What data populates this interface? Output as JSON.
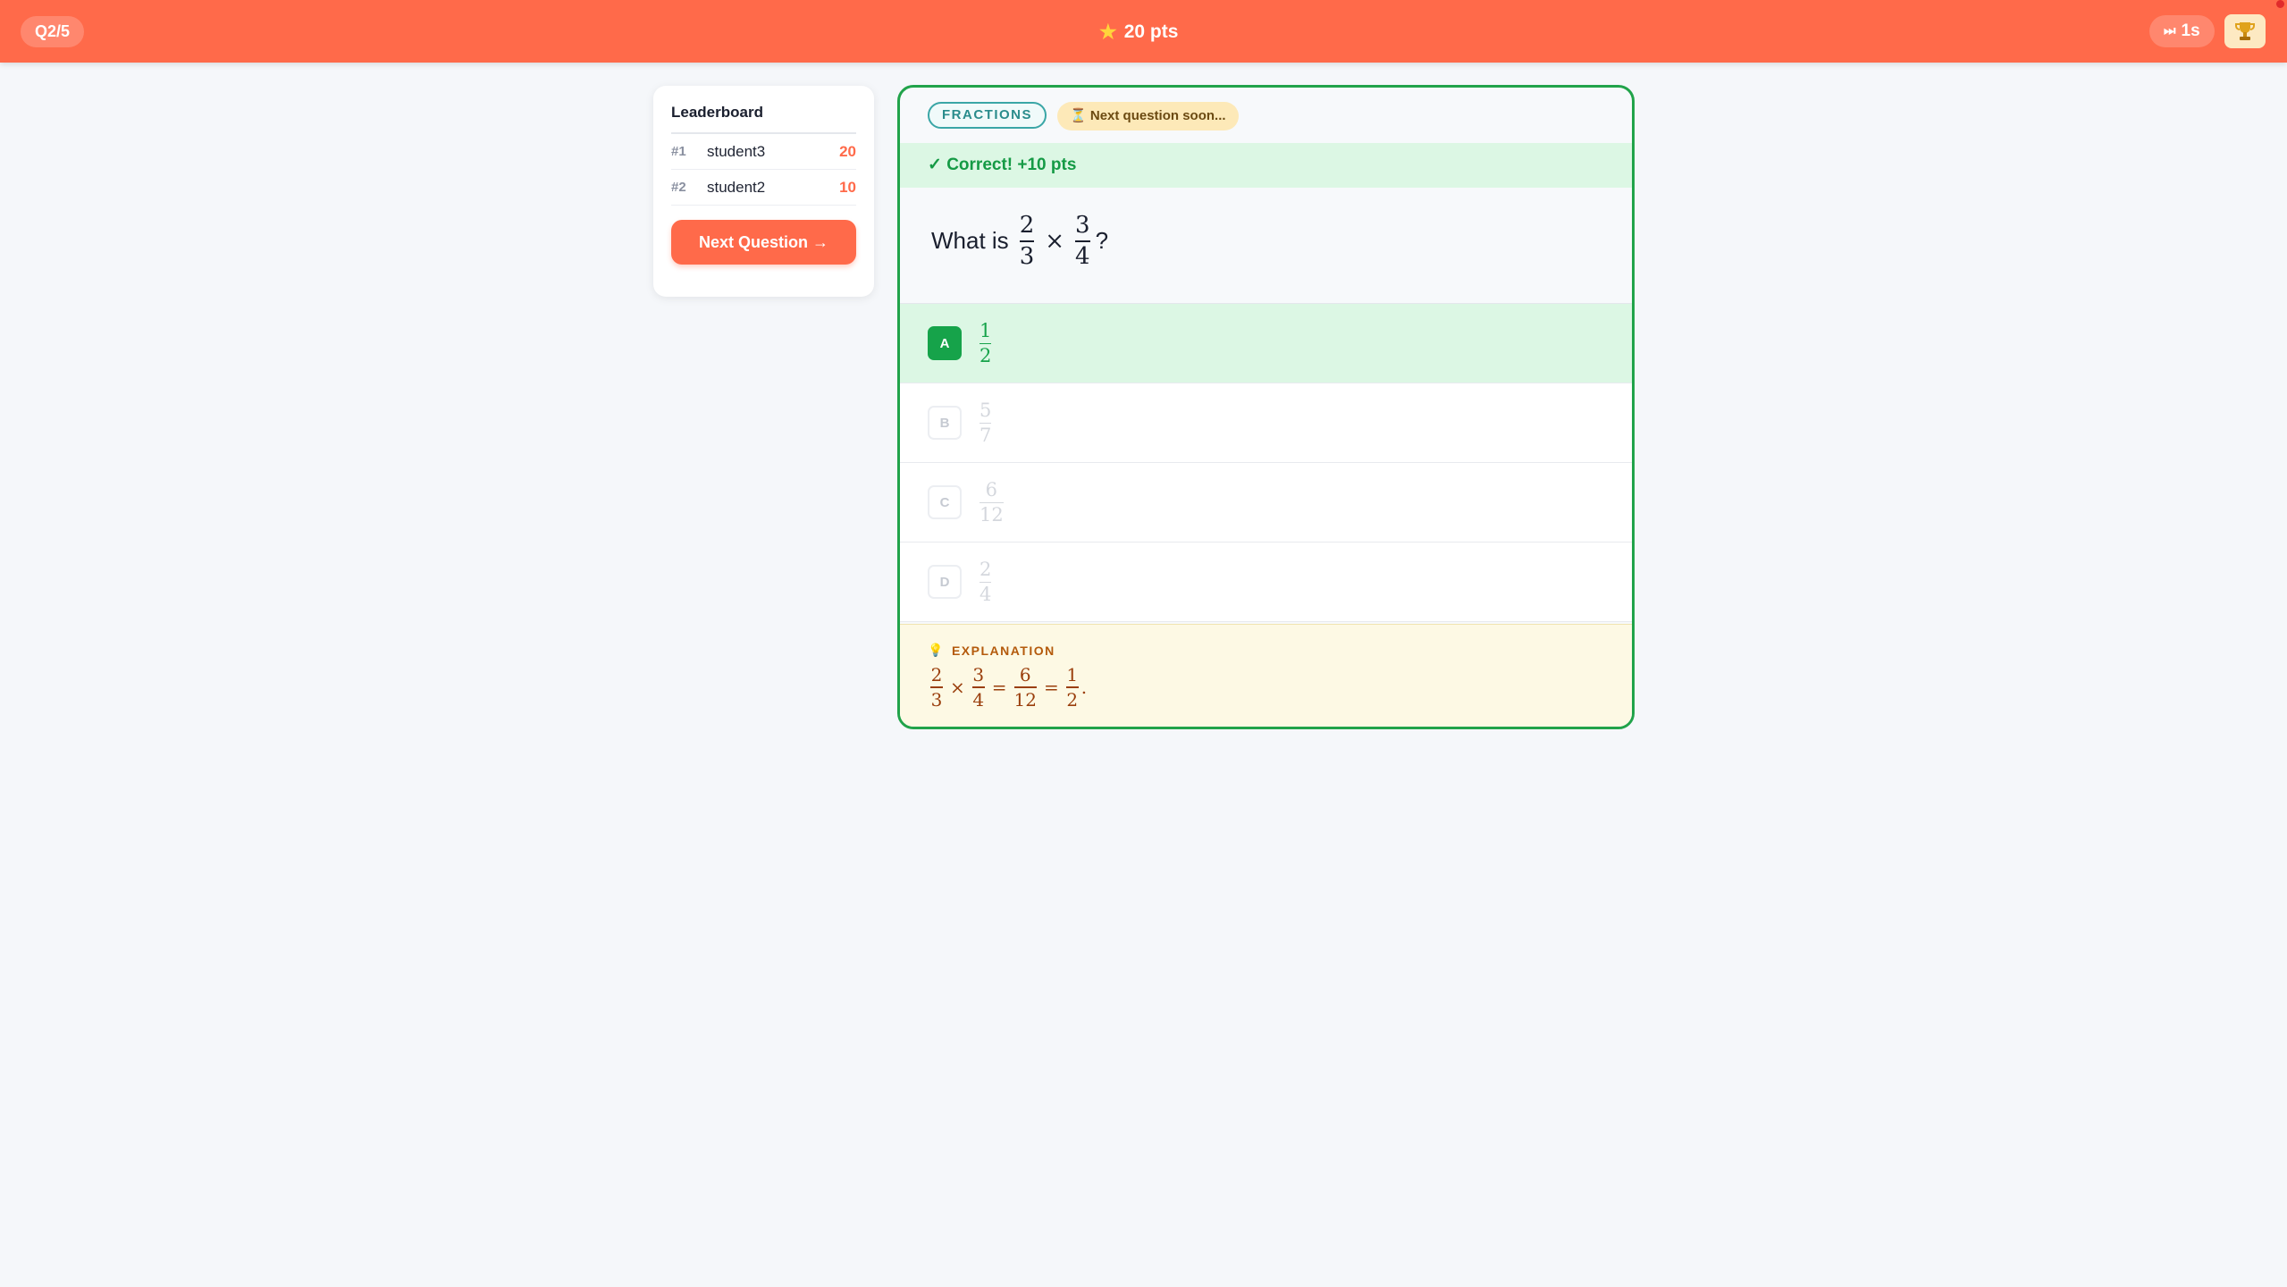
{
  "header": {
    "question_progress": "Q2/5",
    "score_label": "20 pts",
    "timer_label": "1s",
    "icons": {
      "score": "star-icon",
      "timer": "fast-forward-icon",
      "trophy": "trophy-icon"
    }
  },
  "leaderboard": {
    "title": "Leaderboard",
    "entries": [
      {
        "rank": "#1",
        "name": "student3",
        "score": "20"
      },
      {
        "rank": "#2",
        "name": "student2",
        "score": "10"
      }
    ],
    "next_button": "Next Question →"
  },
  "question": {
    "topic_tag": "FRACTIONS",
    "status_tag": "Next question soon...",
    "feedback": "✓ Correct! +10 pts",
    "prompt_prefix": "What is",
    "prompt_suffix": "?",
    "operand1": {
      "num": "2",
      "den": "3"
    },
    "operator": "×",
    "operand2": {
      "num": "3",
      "den": "4"
    },
    "options": [
      {
        "letter": "A",
        "num": "1",
        "den": "2",
        "state": "correct"
      },
      {
        "letter": "B",
        "num": "5",
        "den": "7",
        "state": "disabled"
      },
      {
        "letter": "C",
        "num": "6",
        "den": "12",
        "state": "disabled"
      },
      {
        "letter": "D",
        "num": "2",
        "den": "4",
        "state": "disabled"
      }
    ],
    "explanation": {
      "label": "EXPLANATION",
      "step1": {
        "num": "2",
        "den": "3"
      },
      "op1": "×",
      "step2": {
        "num": "3",
        "den": "4"
      },
      "eq1": "=",
      "step3": {
        "num": "6",
        "den": "12"
      },
      "eq2": "=",
      "step4": {
        "num": "1",
        "den": "2"
      },
      "end": "."
    }
  },
  "colors": {
    "brand": "#ff6a4a",
    "correct": "#16a34a",
    "correct_bg": "#dcf7e4",
    "explanation_bg": "#fdf9e4"
  }
}
